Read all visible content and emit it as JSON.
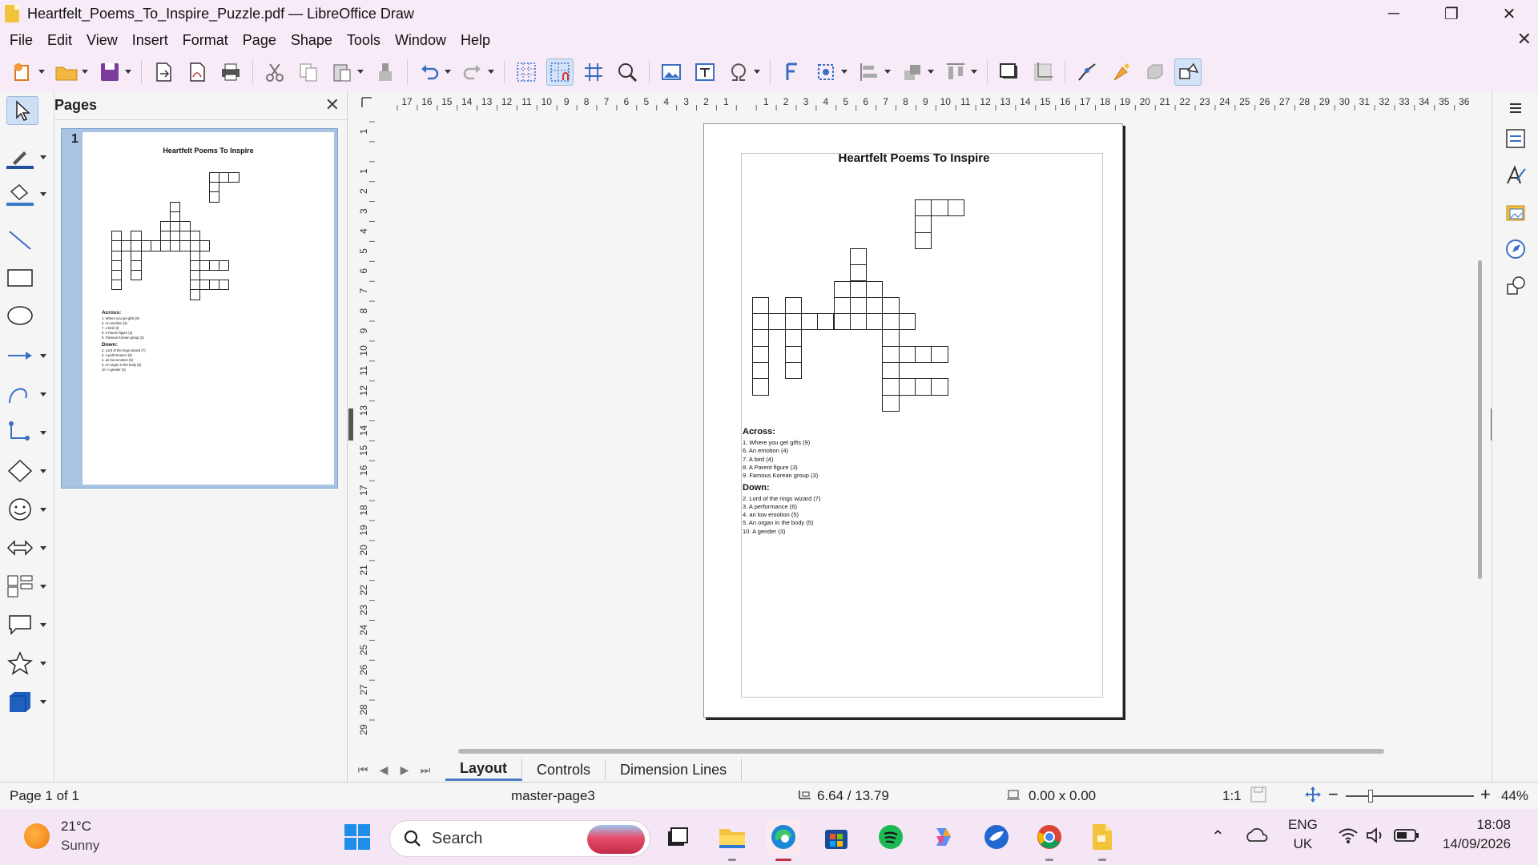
{
  "window": {
    "title": "Heartfelt_Poems_To_Inspire_Puzzle.pdf — LibreOffice Draw",
    "minimize": "─",
    "restore": "❐",
    "close": "✕"
  },
  "menu": {
    "items": [
      "File",
      "Edit",
      "View",
      "Insert",
      "Format",
      "Page",
      "Shape",
      "Tools",
      "Window",
      "Help"
    ],
    "doc_close": "✕"
  },
  "pages_panel": {
    "title": "Pages",
    "close": "✕",
    "page_number": "1"
  },
  "document": {
    "title": "Heartfelt Poems To Inspire",
    "across_heading": "Across:",
    "across": [
      "1. Where you get gifts (9)",
      "6. An emotion (4)",
      "7. A bird (4)",
      "8. A Parent figure (3)",
      "9. Famous Korean group (3)"
    ],
    "down_heading": "Down:",
    "down": [
      "2. Lord of the rings wizard (7)",
      "3. A performance (6)",
      "4. an low emotion (5)",
      "5. An organ in the body (5)",
      "10. A gender (3)"
    ]
  },
  "rulers": {
    "horizontal": [
      "17",
      "16",
      "15",
      "14",
      "13",
      "12",
      "11",
      "10",
      "9",
      "8",
      "7",
      "6",
      "5",
      "4",
      "3",
      "2",
      "1",
      "",
      "1",
      "2",
      "3",
      "4",
      "5",
      "6",
      "7",
      "8",
      "9",
      "10",
      "11",
      "12",
      "13",
      "14",
      "15",
      "16",
      "17",
      "18",
      "19",
      "20",
      "21",
      "22",
      "23",
      "24",
      "25",
      "26",
      "27",
      "28",
      "29",
      "30",
      "31",
      "32",
      "33",
      "34",
      "35",
      "36"
    ],
    "vertical": [
      "1",
      "",
      "1",
      "2",
      "3",
      "4",
      "5",
      "6",
      "7",
      "8",
      "9",
      "10",
      "11",
      "12",
      "13",
      "14",
      "15",
      "16",
      "17",
      "18",
      "19",
      "20",
      "21",
      "22",
      "23",
      "24",
      "25",
      "26",
      "27",
      "28",
      "29"
    ]
  },
  "layer_tabs": {
    "tabs": [
      "Layout",
      "Controls",
      "Dimension Lines"
    ],
    "active": "Layout"
  },
  "status": {
    "page": "Page 1 of 1",
    "master": "master-page3",
    "position": "6.64 / 13.79",
    "size": "0.00 x 0.00",
    "scale": "1:1",
    "zoom": "44%"
  },
  "taskbar": {
    "weather_temp": "21°C",
    "weather_desc": "Sunny",
    "search": "Search",
    "lang_1": "ENG",
    "lang_2": "UK",
    "time": "18:08",
    "date": "14/09/2026"
  },
  "colors": {
    "chrome": "#f7ebf7",
    "taskbar": "#f4e6f4",
    "selection": "#a9c3e2",
    "accent": "#4a7cc0"
  },
  "icons": {
    "toolbar": [
      "new-doc-icon",
      "open-folder-icon",
      "save-icon",
      "export-icon",
      "export-pdf-icon",
      "print-icon",
      "cut-icon",
      "copy-icon",
      "paste-icon",
      "clone-format-icon",
      "undo-icon",
      "redo-icon",
      "grid-icon",
      "helplines-icon",
      "snap-icon",
      "zoom-icon",
      "image-icon",
      "textbox-icon",
      "special-char-icon",
      "fontwork-icon",
      "transform-icon",
      "align-icon",
      "arrange-icon",
      "distribute-icon",
      "shadow-icon",
      "crop-icon",
      "points-icon",
      "glue-icon",
      "toggle-extrusion-icon",
      "shapes-icon"
    ],
    "left": [
      "select-icon",
      "line-color-icon",
      "fill-color-icon",
      "line-icon",
      "rectangle-icon",
      "ellipse-icon",
      "arrow-line-icon",
      "curve-icon",
      "connector-icon",
      "basic-shapes-icon",
      "smiley-icon",
      "block-arrows-icon",
      "flowchart-icon",
      "callout-icon",
      "star-icon",
      "3d-object-icon"
    ],
    "right": [
      "menu-icon",
      "properties-icon",
      "styles-icon",
      "gallery-icon",
      "navigator-icon",
      "shapes-panel-icon"
    ]
  }
}
